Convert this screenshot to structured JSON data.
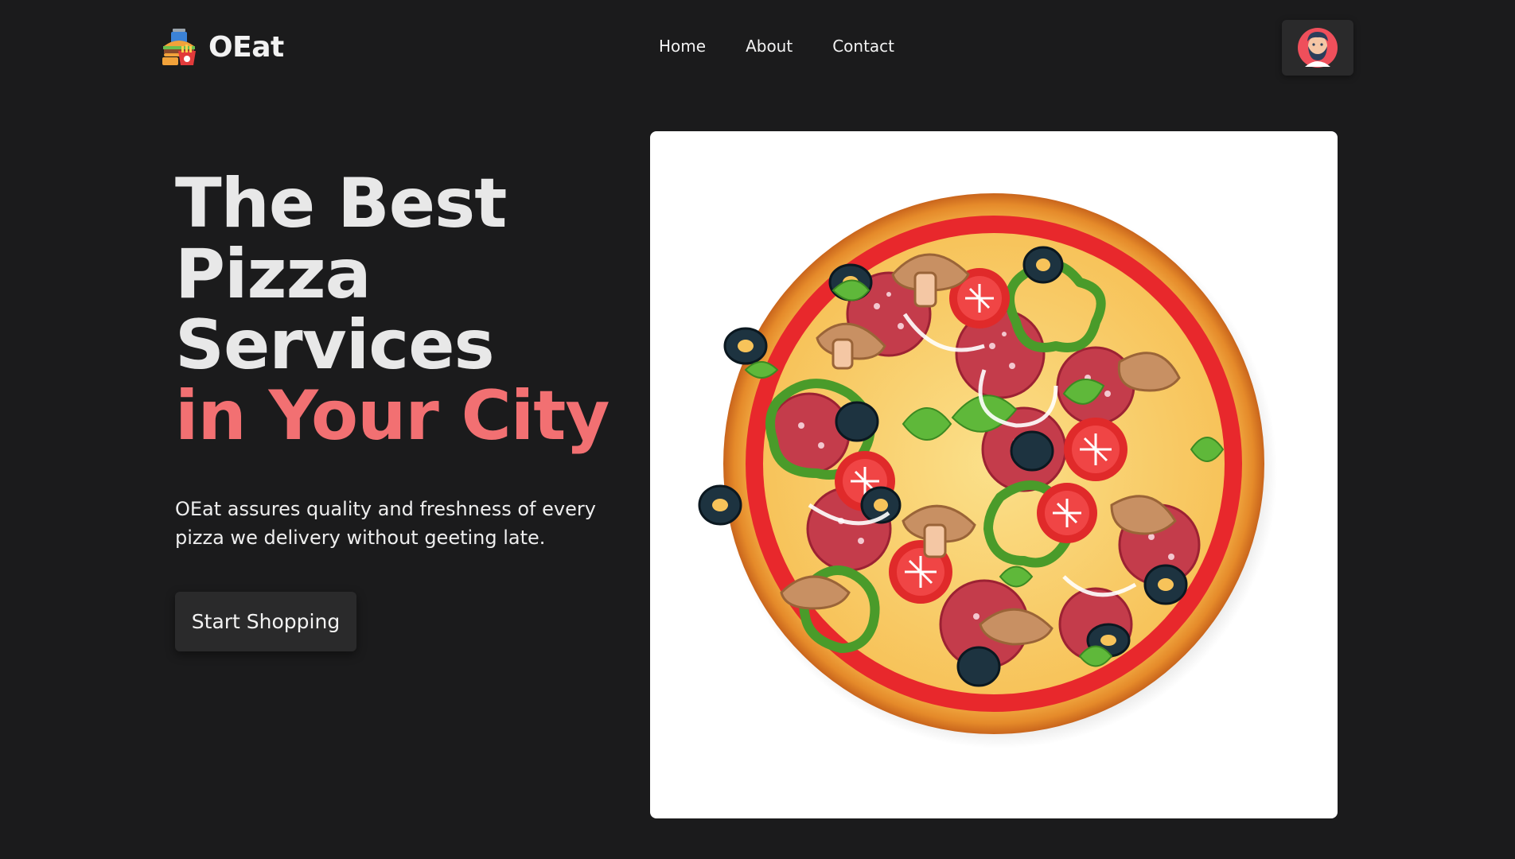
{
  "brand": {
    "name": "OEat",
    "logo_icon": "food-combo-icon"
  },
  "nav": {
    "items": [
      {
        "label": "Home"
      },
      {
        "label": "About"
      },
      {
        "label": "Contact"
      }
    ]
  },
  "user": {
    "avatar_icon": "bearded-man-avatar-icon"
  },
  "hero": {
    "title_lines": [
      "The Best",
      "Pizza",
      "Services"
    ],
    "title_accent": "in Your City",
    "description": "OEat assures quality and freshness of every pizza we delivery without geeting late.",
    "cta_label": "Start Shopping"
  },
  "colors": {
    "background": "#1b1b1c",
    "accent": "#f27072",
    "surface": "#2a2a2b",
    "card": "#ffffff"
  }
}
